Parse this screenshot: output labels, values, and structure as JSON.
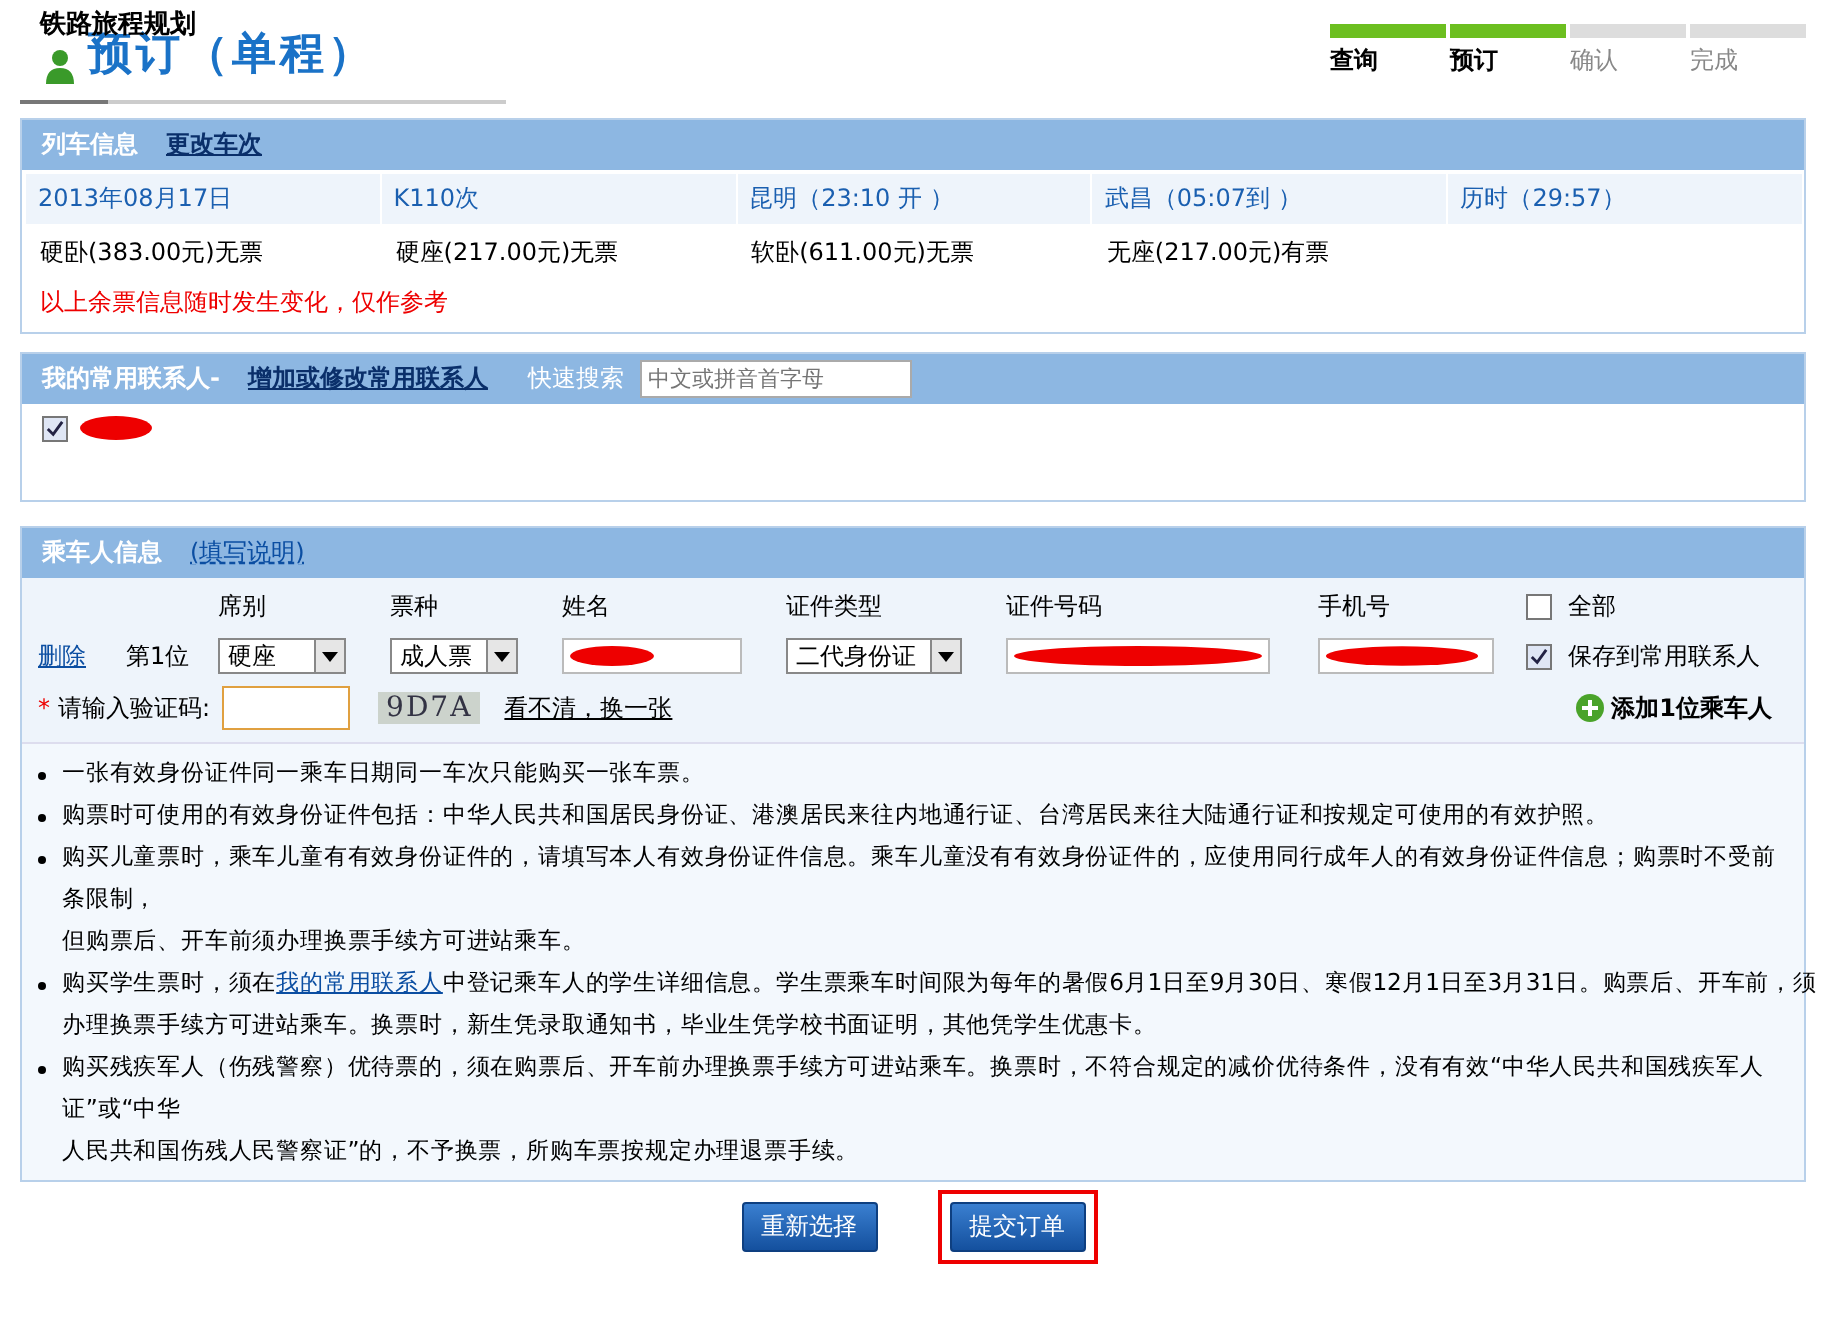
{
  "header": {
    "site": "铁路旅程规划",
    "title": "预订（单程）"
  },
  "steps": [
    {
      "label": "查询",
      "done": true
    },
    {
      "label": "预订",
      "done": true
    },
    {
      "label": "确认",
      "done": false
    },
    {
      "label": "完成",
      "done": false
    }
  ],
  "train": {
    "title": "列车信息",
    "change_link": "更改车次",
    "info": [
      "2013年08月17日",
      "K110次",
      "昆明（23:10 开 ）",
      "武昌（05:07到 ）",
      "历时（29:57）"
    ],
    "seats": [
      "硬卧(383.00元)无票",
      "硬座(217.00元)无票",
      "软卧(611.00元)无票",
      "无座(217.00元)有票"
    ],
    "warning": "以上余票信息随时发生变化，仅作参考"
  },
  "contacts": {
    "title": "我的常用联系人-",
    "edit_link": "增加或修改常用联系人",
    "search_label": "快速搜索",
    "search": {
      "placeholder": "中文或拼音首字母"
    },
    "items": [
      {
        "checked": true,
        "redacted": true
      }
    ]
  },
  "passengers": {
    "title": "乘车人信息",
    "help_link": "(填写说明)",
    "columns": [
      "席别",
      "票种",
      "姓名",
      "证件类型",
      "证件号码",
      "手机号"
    ],
    "all": {
      "label": "全部",
      "checked": false
    },
    "rows": [
      {
        "delete": "删除",
        "position": "第1位",
        "seat": "硬座",
        "ticket": "成人票",
        "name_redacted": true,
        "id_type": "二代身份证",
        "id_redacted": true,
        "phone_redacted": true,
        "save": {
          "label": "保存到常用联系人",
          "checked": true
        }
      }
    ],
    "captcha": {
      "required_mark": "*",
      "label": "请输入验证码:",
      "image_text": "9D7A",
      "refresh_link": "看不清，换一张"
    },
    "add_link": "添加1位乘车人",
    "notes": [
      [
        [
          {
            "text": "一张有效身份证件同一乘车日期同一车次只能购买一张车票。"
          }
        ]
      ],
      [
        [
          {
            "text": "购票时可使用的有效身份证件包括：中华人民共和国居民身份证、港澳居民来往内地通行证、台湾居民来往大陆通行证和按规定可使用的有效护照。"
          }
        ]
      ],
      [
        [
          {
            "text": "购买儿童票时，乘车儿童有有效身份证件的，请填写本人有效身份证件信息。乘车儿童没有有效身份证件的，应使用同行成年人的有效身份证件信息；购票时不受前"
          }
        ],
        [
          {
            "text": "条限制，"
          }
        ],
        [
          {
            "text": "但购票后、开车前须办理换票手续方可进站乘车。"
          }
        ]
      ],
      [
        [
          {
            "text": "购买学生票时，须在"
          },
          {
            "text": "我的常用联系人",
            "link": true
          },
          {
            "text": "中登记乘车人的学生详细信息。学生票乘车时间限为每年的暑假6月1日至9月30日、寒假12月1日至3月31日。购票后、开车前，须"
          }
        ],
        [
          {
            "text": "办理换票手续方可进站乘车。换票时，新生凭录取通知书，毕业生凭学校书面证明，其他凭学生优惠卡。"
          }
        ]
      ],
      [
        [
          {
            "text": "购买残疾军人（伤残警察）优待票的，须在购票后、开车前办理换票手续方可进站乘车。换票时，不符合规定的减价优待条件，没有有效“中华人民共和国残疾军人"
          }
        ],
        [
          {
            "text": "证”或“中华"
          }
        ],
        [
          {
            "text": "人民共和国伤残人民警察证”的，不予换票，所购车票按规定办理退票手续。"
          }
        ]
      ]
    ]
  },
  "buttons": [
    {
      "label": "重新选择",
      "highlighted": false
    },
    {
      "label": "提交订单",
      "highlighted": true
    }
  ]
}
